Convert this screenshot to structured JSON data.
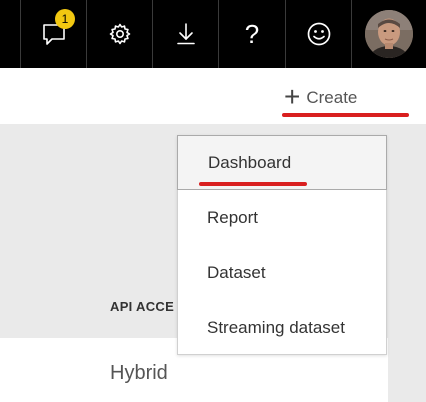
{
  "topbar": {
    "notifications_badge": "1",
    "help_glyph": "?",
    "icons": {
      "notifications": "chat-bubble-icon",
      "settings": "gear-icon",
      "download": "download-icon",
      "help": "question-mark-icon",
      "feedback": "smiley-icon",
      "profile": "avatar"
    }
  },
  "create": {
    "label": "Create",
    "icon": "plus-icon"
  },
  "menu": {
    "items": [
      {
        "label": "Dashboard"
      },
      {
        "label": "Report"
      },
      {
        "label": "Dataset"
      },
      {
        "label": "Streaming dataset"
      }
    ]
  },
  "table": {
    "column_header": "API ACCE",
    "row_value": "Hybrid"
  },
  "colors": {
    "topbar": "#000000",
    "badge": "#f2c811",
    "annotation_underline": "#d91f1f",
    "content_background": "#eaeaea"
  }
}
